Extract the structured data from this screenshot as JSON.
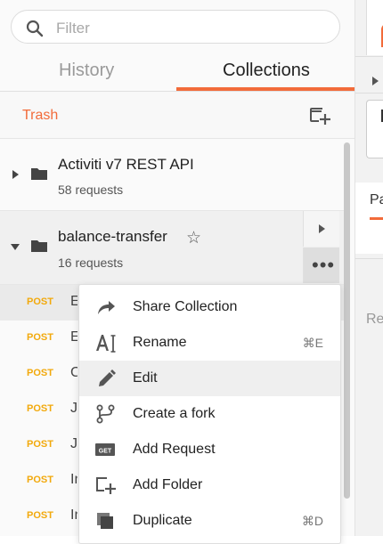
{
  "search": {
    "placeholder": "Filter"
  },
  "tabs": {
    "history": "History",
    "collections": "Collections"
  },
  "toolbar": {
    "trash": "Trash"
  },
  "collections": [
    {
      "name": "Activiti v7 REST API",
      "count": "58 requests",
      "expanded": false
    },
    {
      "name": "balance-transfer",
      "count": "16 requests",
      "expanded": true
    }
  ],
  "requests": [
    {
      "method": "POST",
      "name": "E"
    },
    {
      "method": "POST",
      "name": "E"
    },
    {
      "method": "POST",
      "name": "C"
    },
    {
      "method": "POST",
      "name": "Jo"
    },
    {
      "method": "POST",
      "name": "Jo"
    },
    {
      "method": "POST",
      "name": "In"
    },
    {
      "method": "POST",
      "name": "In"
    }
  ],
  "menu": {
    "items": [
      {
        "label": "Share Collection",
        "shortcut": "",
        "icon": "share-arrow-icon"
      },
      {
        "label": "Rename",
        "shortcut": "⌘E",
        "icon": "rename-text-cursor-icon"
      },
      {
        "label": "Edit",
        "shortcut": "",
        "icon": "pencil-icon"
      },
      {
        "label": "Create a fork",
        "shortcut": "",
        "icon": "fork-icon"
      },
      {
        "label": "Add Request",
        "shortcut": "",
        "icon": "get-badge-icon"
      },
      {
        "label": "Add Folder",
        "shortcut": "",
        "icon": "add-folder-icon"
      },
      {
        "label": "Duplicate",
        "shortcut": "⌘D",
        "icon": "duplicate-icon"
      }
    ],
    "hovered_index": 2
  },
  "right_pane": {
    "tab_label_partial": "Pa",
    "section_label_partial": "Re"
  },
  "colors": {
    "accent": "#f26b3a",
    "post_method": "#f2a90c"
  }
}
